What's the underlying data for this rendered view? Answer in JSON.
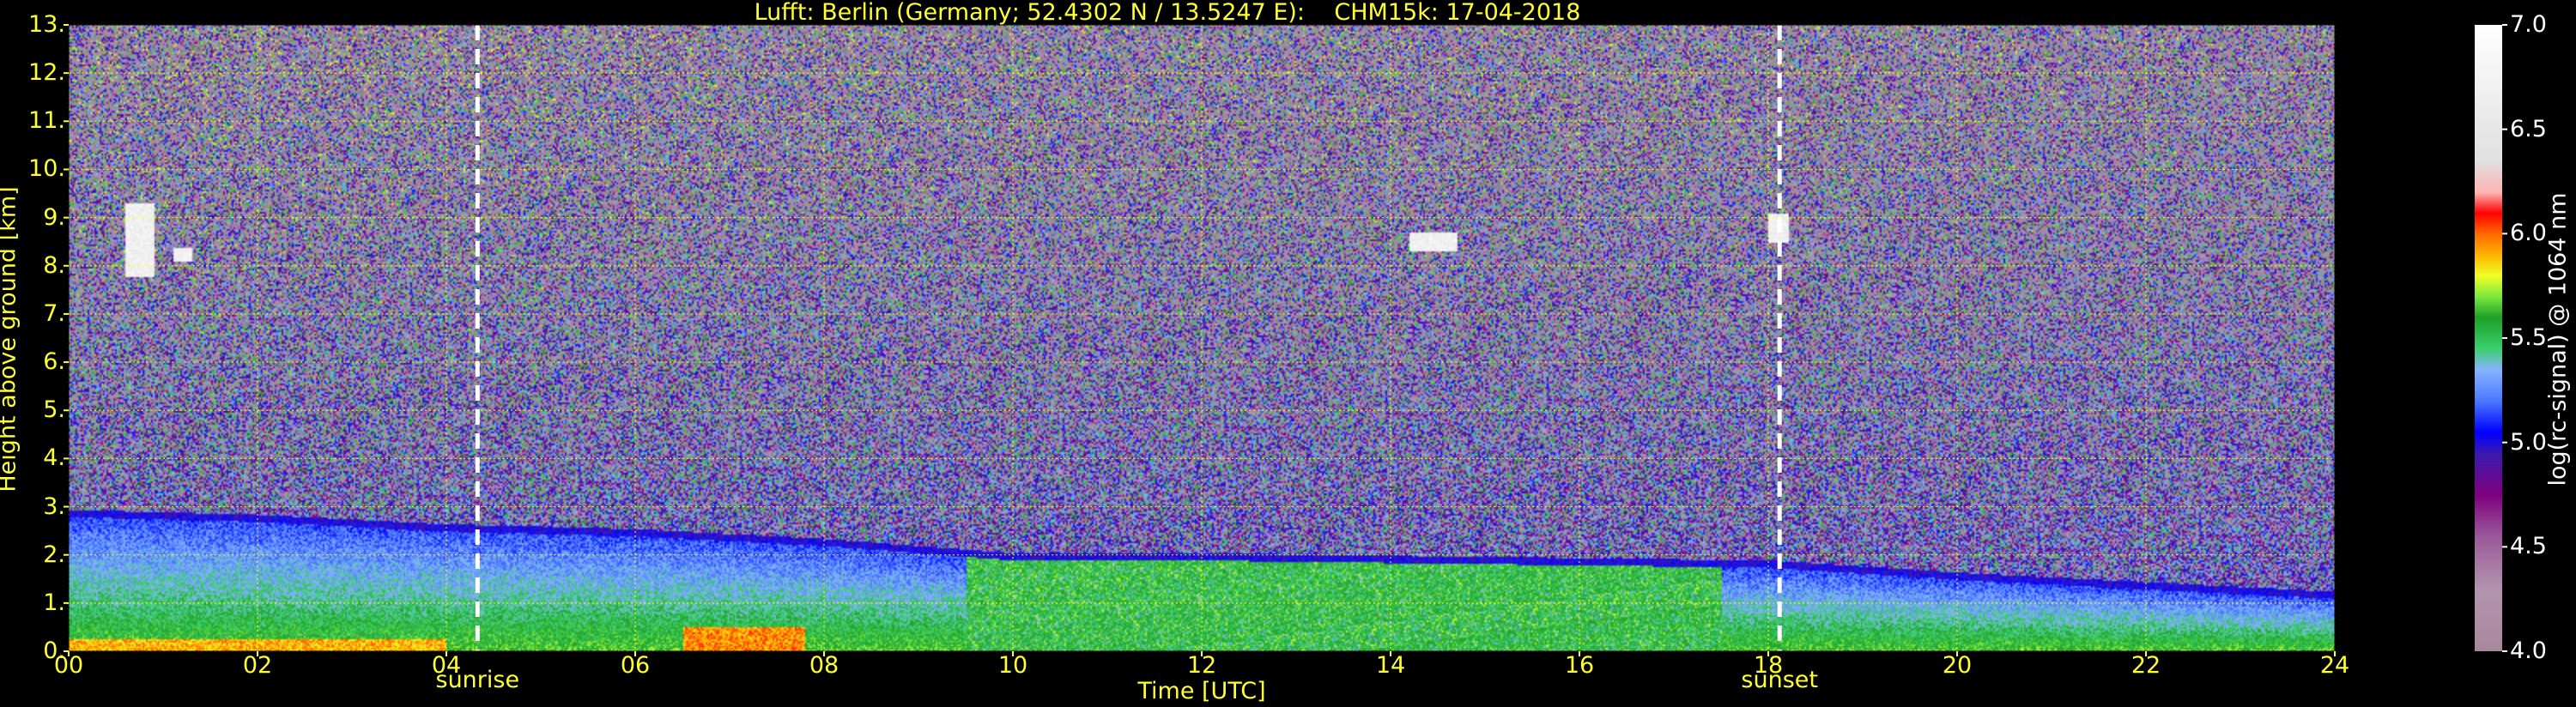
{
  "chart_data": {
    "type": "heatmap",
    "title": "Lufft: Berlin (Germany; 52.4302 N / 13.5247 E):    CHM15k: 17-04-2018",
    "xlabel": "Time [UTC]",
    "ylabel": "Height above ground [km]",
    "xlim": [
      0,
      24
    ],
    "ylim": [
      0,
      13
    ],
    "x_ticks": [
      "00",
      "02",
      "04",
      "06",
      "08",
      "10",
      "12",
      "14",
      "16",
      "18",
      "20",
      "22",
      "24"
    ],
    "x_tick_values": [
      0,
      2,
      4,
      6,
      8,
      10,
      12,
      14,
      16,
      18,
      20,
      22,
      24
    ],
    "y_ticks": [
      "0.",
      "1.",
      "2.",
      "3.",
      "4.",
      "5.",
      "6.",
      "7.",
      "8.",
      "9.",
      "10.",
      "11.",
      "12.",
      "13."
    ],
    "y_tick_values": [
      0,
      1,
      2,
      3,
      4,
      5,
      6,
      7,
      8,
      9,
      10,
      11,
      12,
      13
    ],
    "grid": true,
    "grid_color": "#ffff00",
    "events": [
      {
        "label": "sunrise",
        "time": 4.33
      },
      {
        "label": "sunset",
        "time": 18.12
      }
    ],
    "colorbar": {
      "label": "log(rc-signal) @ 1064 nm",
      "range": [
        4.0,
        7.0
      ],
      "ticks": [
        "4.0",
        "4.5",
        "5.0",
        "5.5",
        "6.0",
        "6.5",
        "7.0"
      ],
      "tick_values": [
        4.0,
        4.5,
        5.0,
        5.5,
        6.0,
        6.5,
        7.0
      ],
      "colors": [
        {
          "v": 4.0,
          "c": "#a8889c"
        },
        {
          "v": 4.3,
          "c": "#b294ae"
        },
        {
          "v": 4.55,
          "c": "#9b5a9b"
        },
        {
          "v": 4.75,
          "c": "#800080"
        },
        {
          "v": 4.95,
          "c": "#3a1ab0"
        },
        {
          "v": 5.05,
          "c": "#0000ff"
        },
        {
          "v": 5.2,
          "c": "#4a78ff"
        },
        {
          "v": 5.35,
          "c": "#86b4ff"
        },
        {
          "v": 5.45,
          "c": "#3cd06e"
        },
        {
          "v": 5.6,
          "c": "#1ea028"
        },
        {
          "v": 5.7,
          "c": "#7ce83c"
        },
        {
          "v": 5.8,
          "c": "#f0ff28"
        },
        {
          "v": 5.9,
          "c": "#ffb400"
        },
        {
          "v": 6.0,
          "c": "#ff6a00"
        },
        {
          "v": 6.1,
          "c": "#ff0000"
        },
        {
          "v": 6.2,
          "c": "#ffb4b4"
        },
        {
          "v": 6.35,
          "c": "#e0e0e0"
        },
        {
          "v": 7.0,
          "c": "#ffffff"
        }
      ]
    },
    "features": {
      "boundary_layer_top_km": [
        {
          "t": 0,
          "h": 2.8
        },
        {
          "t": 2,
          "h": 2.7
        },
        {
          "t": 4,
          "h": 2.5
        },
        {
          "t": 6,
          "h": 2.4
        },
        {
          "t": 8,
          "h": 2.2
        },
        {
          "t": 10,
          "h": 1.9
        },
        {
          "t": 12,
          "h": 1.9
        },
        {
          "t": 14,
          "h": 1.85
        },
        {
          "t": 16,
          "h": 1.8
        },
        {
          "t": 18,
          "h": 1.75
        },
        {
          "t": 20,
          "h": 1.5
        },
        {
          "t": 22,
          "h": 1.3
        },
        {
          "t": 24,
          "h": 1.1
        }
      ],
      "cirrus": [
        {
          "t0": 0.6,
          "t1": 0.9,
          "h0": 7.8,
          "h1": 9.3
        },
        {
          "t0": 1.1,
          "t1": 1.3,
          "h0": 8.1,
          "h1": 8.4
        },
        {
          "t0": 14.2,
          "t1": 14.7,
          "h0": 8.3,
          "h1": 8.7
        },
        {
          "t0": 18.0,
          "t1": 18.2,
          "h0": 8.5,
          "h1": 9.1
        }
      ]
    }
  }
}
